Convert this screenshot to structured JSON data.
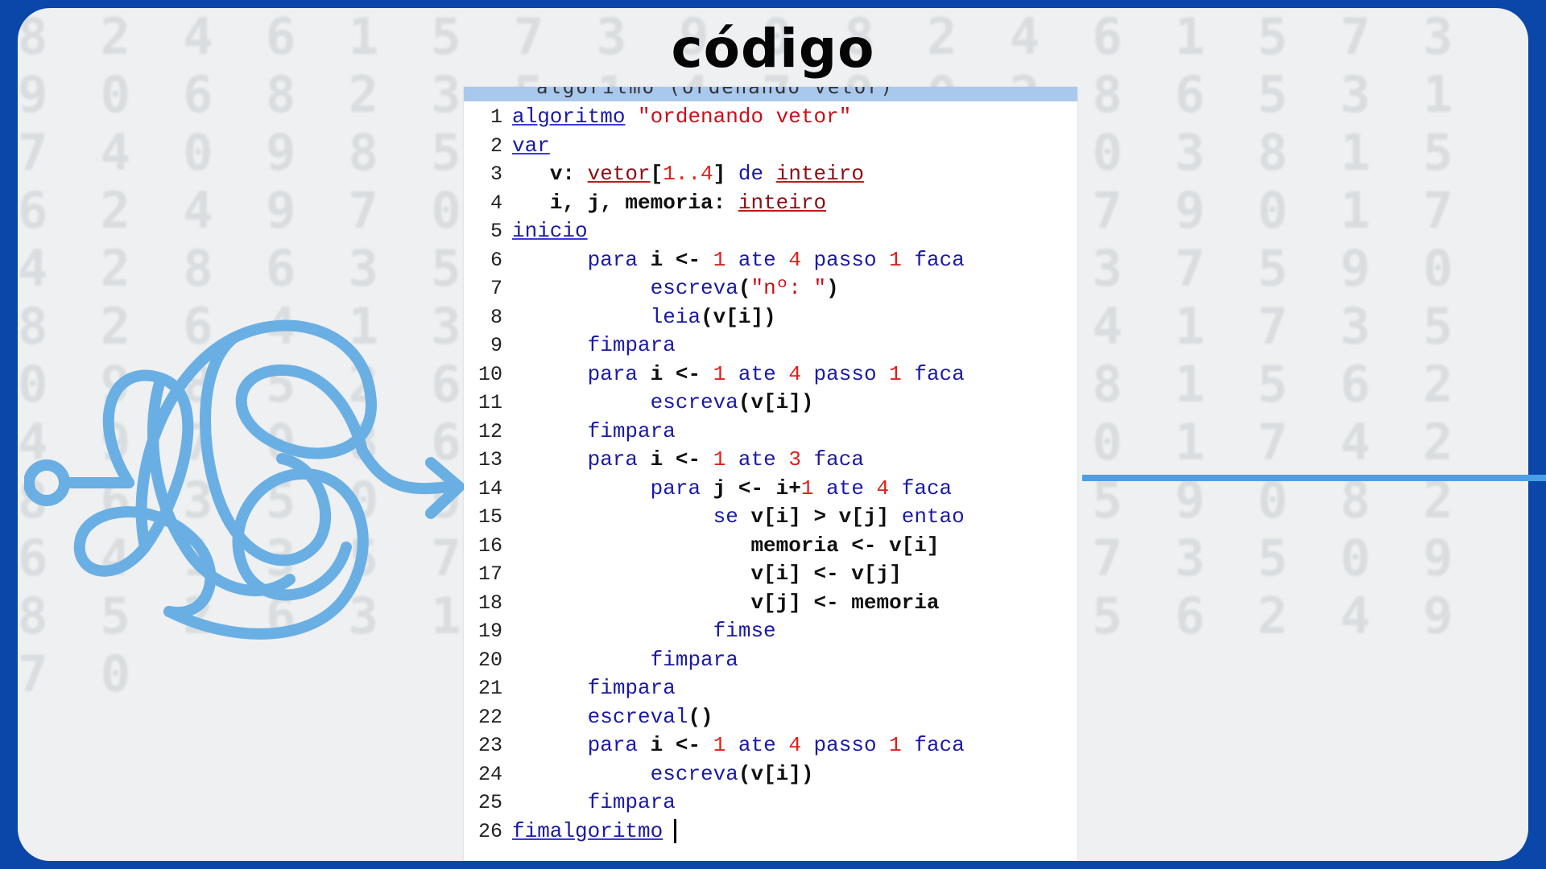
{
  "title": "código",
  "background_digits": "8 2 4 6 1 5 7 3 9 0 8 2 4 6 1 5 7 3 9 0 6 8 2 3 5 1 4 7 9 0 2 8 6 5 3 1 7 4 0 9 8 5 2 6 3 1 4 7 9 0 3 8 1 5 6 2 4 9 7 0 8 6 2 3 1 5 4 7 9 0 1 7 4 2 8 6 3 5 0 9 2 4 8 1 6 3 7 5 9 0 8 2 6 4 1 3 5 7 9 0 6 2 8 4 1 7 3 5 0 9 8 5 2 6 3 1 4 7 9 0 3 8 1 5 6 2 4 9 7 0 8 6 2 3 1 5 4 7 9 0 1 7 4 2 8 6 3 5 0 9 2 4 8 1 6 3 7 5 9 0 8 2 6 4 1 3 5 7 9 0 6 2 8 4 1 7 3 5 0 9 8 5 2 6 3 1 4 7 9 0 3 8 1 5 6 2 4 9 7 0",
  "colors": {
    "frame": "#0a47a8",
    "card": "#eef0f1",
    "accent_line": "#4aa0e8",
    "scribble": "#6aafe4",
    "keyword": "#1a1aa6",
    "string": "#c8101a",
    "number": "#e0201a",
    "type": "#8a0f14"
  },
  "editor": {
    "topbar_ghost": "algoritmo (ordenando vetor)",
    "lines": [
      {
        "n": "1",
        "tokens": [
          [
            "kwu",
            "algoritmo"
          ],
          [
            "t",
            " "
          ],
          [
            "str",
            "\"ordenando vetor\""
          ]
        ]
      },
      {
        "n": "2",
        "tokens": [
          [
            "kwu",
            "var"
          ]
        ]
      },
      {
        "n": "3",
        "tokens": [
          [
            "t",
            "   "
          ],
          [
            "id",
            "v: "
          ],
          [
            "typ",
            "vetor"
          ],
          [
            "id",
            "["
          ],
          [
            "num",
            "1..4"
          ],
          [
            "id",
            "]"
          ],
          [
            "t",
            " "
          ],
          [
            "kw",
            "de"
          ],
          [
            "t",
            " "
          ],
          [
            "typ",
            "inteiro"
          ]
        ]
      },
      {
        "n": "4",
        "tokens": [
          [
            "t",
            "   "
          ],
          [
            "id",
            "i, j, memoria: "
          ],
          [
            "typ",
            "inteiro"
          ]
        ]
      },
      {
        "n": "5",
        "tokens": [
          [
            "kwu",
            "inicio"
          ]
        ]
      },
      {
        "n": "6",
        "tokens": [
          [
            "t",
            "      "
          ],
          [
            "kw",
            "para"
          ],
          [
            "t",
            " "
          ],
          [
            "id",
            "i <-"
          ],
          [
            "t",
            " "
          ],
          [
            "num",
            "1"
          ],
          [
            "t",
            " "
          ],
          [
            "kw",
            "ate"
          ],
          [
            "t",
            " "
          ],
          [
            "num",
            "4"
          ],
          [
            "t",
            " "
          ],
          [
            "kw",
            "passo"
          ],
          [
            "t",
            " "
          ],
          [
            "num",
            "1"
          ],
          [
            "t",
            " "
          ],
          [
            "kw",
            "faca"
          ]
        ]
      },
      {
        "n": "7",
        "tokens": [
          [
            "t",
            "           "
          ],
          [
            "kw",
            "escreva"
          ],
          [
            "id",
            "("
          ],
          [
            "str",
            "\"nº: \""
          ],
          [
            "id",
            ")"
          ]
        ]
      },
      {
        "n": "8",
        "tokens": [
          [
            "t",
            "           "
          ],
          [
            "kw",
            "leia"
          ],
          [
            "id",
            "(v[i])"
          ]
        ]
      },
      {
        "n": "9",
        "tokens": [
          [
            "t",
            "      "
          ],
          [
            "kw",
            "fimpara"
          ]
        ]
      },
      {
        "n": "10",
        "tokens": [
          [
            "t",
            "      "
          ],
          [
            "kw",
            "para"
          ],
          [
            "t",
            " "
          ],
          [
            "id",
            "i <-"
          ],
          [
            "t",
            " "
          ],
          [
            "num",
            "1"
          ],
          [
            "t",
            " "
          ],
          [
            "kw",
            "ate"
          ],
          [
            "t",
            " "
          ],
          [
            "num",
            "4"
          ],
          [
            "t",
            " "
          ],
          [
            "kw",
            "passo"
          ],
          [
            "t",
            " "
          ],
          [
            "num",
            "1"
          ],
          [
            "t",
            " "
          ],
          [
            "kw",
            "faca"
          ]
        ]
      },
      {
        "n": "11",
        "tokens": [
          [
            "t",
            "           "
          ],
          [
            "kw",
            "escreva"
          ],
          [
            "id",
            "(v[i])"
          ]
        ]
      },
      {
        "n": "12",
        "tokens": [
          [
            "t",
            "      "
          ],
          [
            "kw",
            "fimpara"
          ]
        ]
      },
      {
        "n": "13",
        "tokens": [
          [
            "t",
            "      "
          ],
          [
            "kw",
            "para"
          ],
          [
            "t",
            " "
          ],
          [
            "id",
            "i <-"
          ],
          [
            "t",
            " "
          ],
          [
            "num",
            "1"
          ],
          [
            "t",
            " "
          ],
          [
            "kw",
            "ate"
          ],
          [
            "t",
            " "
          ],
          [
            "num",
            "3"
          ],
          [
            "t",
            " "
          ],
          [
            "kw",
            "faca"
          ]
        ]
      },
      {
        "n": "14",
        "tokens": [
          [
            "t",
            "           "
          ],
          [
            "kw",
            "para"
          ],
          [
            "t",
            " "
          ],
          [
            "id",
            "j <- i+"
          ],
          [
            "num",
            "1"
          ],
          [
            "t",
            " "
          ],
          [
            "kw",
            "ate"
          ],
          [
            "t",
            " "
          ],
          [
            "num",
            "4"
          ],
          [
            "t",
            " "
          ],
          [
            "kw",
            "faca"
          ]
        ]
      },
      {
        "n": "15",
        "tokens": [
          [
            "t",
            "                "
          ],
          [
            "kw",
            "se"
          ],
          [
            "t",
            " "
          ],
          [
            "id",
            "v[i] > v[j]"
          ],
          [
            "t",
            " "
          ],
          [
            "kw",
            "entao"
          ]
        ]
      },
      {
        "n": "16",
        "tokens": [
          [
            "t",
            "                   "
          ],
          [
            "id",
            "memoria <- v[i]"
          ]
        ]
      },
      {
        "n": "17",
        "tokens": [
          [
            "t",
            "                   "
          ],
          [
            "id",
            "v[i] <- v[j]"
          ]
        ]
      },
      {
        "n": "18",
        "tokens": [
          [
            "t",
            "                   "
          ],
          [
            "id",
            "v[j] <- memoria"
          ]
        ]
      },
      {
        "n": "19",
        "tokens": [
          [
            "t",
            "                "
          ],
          [
            "kw",
            "fimse"
          ]
        ]
      },
      {
        "n": "20",
        "tokens": [
          [
            "t",
            "           "
          ],
          [
            "kw",
            "fimpara"
          ]
        ]
      },
      {
        "n": "21",
        "tokens": [
          [
            "t",
            "      "
          ],
          [
            "kw",
            "fimpara"
          ]
        ]
      },
      {
        "n": "22",
        "tokens": [
          [
            "t",
            "      "
          ],
          [
            "kw",
            "escreval"
          ],
          [
            "id",
            "()"
          ]
        ]
      },
      {
        "n": "23",
        "tokens": [
          [
            "t",
            "      "
          ],
          [
            "kw",
            "para"
          ],
          [
            "t",
            " "
          ],
          [
            "id",
            "i <-"
          ],
          [
            "t",
            " "
          ],
          [
            "num",
            "1"
          ],
          [
            "t",
            " "
          ],
          [
            "kw",
            "ate"
          ],
          [
            "t",
            " "
          ],
          [
            "num",
            "4"
          ],
          [
            "t",
            " "
          ],
          [
            "kw",
            "passo"
          ],
          [
            "t",
            " "
          ],
          [
            "num",
            "1"
          ],
          [
            "t",
            " "
          ],
          [
            "kw",
            "faca"
          ]
        ]
      },
      {
        "n": "24",
        "tokens": [
          [
            "t",
            "           "
          ],
          [
            "kw",
            "escreva"
          ],
          [
            "id",
            "(v[i])"
          ]
        ]
      },
      {
        "n": "25",
        "tokens": [
          [
            "t",
            "      "
          ],
          [
            "kw",
            "fimpara"
          ]
        ]
      },
      {
        "n": "26",
        "tokens": [
          [
            "kwu",
            "fimalgoritmo"
          ]
        ],
        "caret": true
      }
    ]
  },
  "icons": {
    "scribble": "tangled-arrow-icon"
  }
}
